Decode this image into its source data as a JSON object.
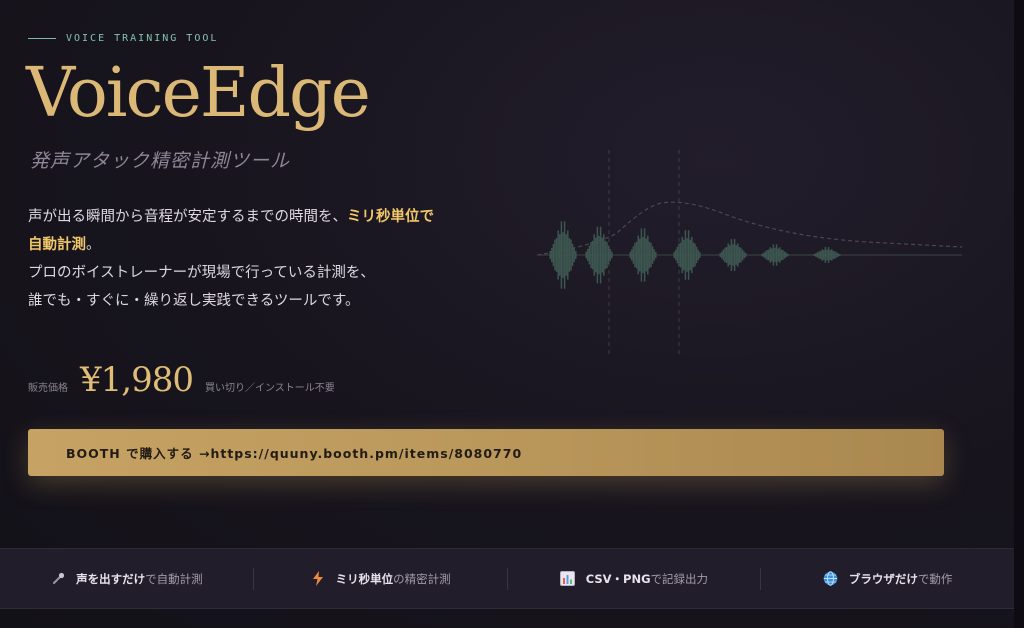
{
  "hero": {
    "eyebrow": "VOICE TRAINING TOOL",
    "title": "VoiceEdge",
    "subtitle": "発声アタック精密計測ツール",
    "description": {
      "line1_a": "声が出る瞬間から音程が安定するまでの時間を、",
      "line1_highlight": "ミリ秒単位で",
      "line2_highlight": "自動計測",
      "line2_b": "。",
      "line3": "プロのボイストレーナーが現場で行っている計測を、",
      "line4": "誰でも・すぐに・繰り返し実践できるツールです。"
    }
  },
  "price": {
    "label": "販売価格",
    "value": "¥1,980",
    "note": "買い切り／インストール不要"
  },
  "buy_button": {
    "label": "BOOTH で購入する →https://quuny.booth.pm/items/8080770"
  },
  "features": [
    {
      "icon": "microphone-icon",
      "strong": "声を出すだけ",
      "rest": "で自動計測"
    },
    {
      "icon": "lightning-icon",
      "strong": "ミリ秒単位",
      "rest": "の精密計測"
    },
    {
      "icon": "bar-chart-icon",
      "strong": "CSV・PNG",
      "rest": "で記録出力"
    },
    {
      "icon": "globe-icon",
      "strong": "ブラウザだけ",
      "rest": "で動作"
    }
  ],
  "colors": {
    "accent_gold": "#dcb877",
    "highlight": "#f0c76a",
    "eyebrow_teal": "#86c3ad",
    "background": "#17141d"
  }
}
